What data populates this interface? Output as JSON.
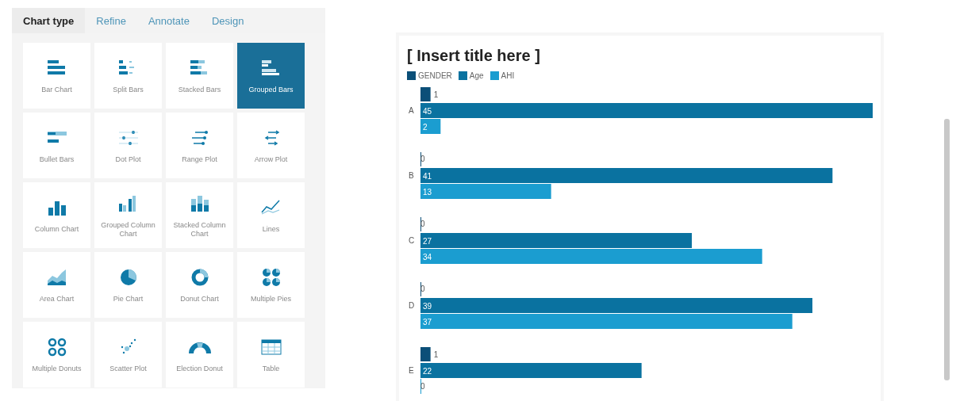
{
  "tabs": [
    {
      "label": "Chart type",
      "selected": true
    },
    {
      "label": "Refine",
      "selected": false
    },
    {
      "label": "Annotate",
      "selected": false
    },
    {
      "label": "Design",
      "selected": false
    }
  ],
  "chart_types": [
    {
      "label": "Bar Chart",
      "kind": "bar",
      "selected": false
    },
    {
      "label": "Split Bars",
      "kind": "split",
      "selected": false
    },
    {
      "label": "Stacked Bars",
      "kind": "stacked",
      "selected": false
    },
    {
      "label": "Grouped Bars",
      "kind": "grouped",
      "selected": true
    },
    {
      "label": "Bullet Bars",
      "kind": "bullet",
      "selected": false
    },
    {
      "label": "Dot Plot",
      "kind": "dot",
      "selected": false
    },
    {
      "label": "Range Plot",
      "kind": "range",
      "selected": false
    },
    {
      "label": "Arrow Plot",
      "kind": "arrow",
      "selected": false
    },
    {
      "label": "Column Chart",
      "kind": "column",
      "selected": false
    },
    {
      "label": "Grouped Column Chart",
      "kind": "grouped-column",
      "selected": false
    },
    {
      "label": "Stacked Column Chart",
      "kind": "stacked-column",
      "selected": false
    },
    {
      "label": "Lines",
      "kind": "lines",
      "selected": false
    },
    {
      "label": "Area Chart",
      "kind": "area",
      "selected": false
    },
    {
      "label": "Pie Chart",
      "kind": "pie",
      "selected": false
    },
    {
      "label": "Donut Chart",
      "kind": "donut",
      "selected": false
    },
    {
      "label": "Multiple Pies",
      "kind": "multi-pie",
      "selected": false
    },
    {
      "label": "Multiple Donuts",
      "kind": "multi-donut",
      "selected": false
    },
    {
      "label": "Scatter Plot",
      "kind": "scatter",
      "selected": false
    },
    {
      "label": "Election Donut",
      "kind": "election",
      "selected": false
    },
    {
      "label": "Table",
      "kind": "table",
      "selected": false
    }
  ],
  "preview": {
    "chart_data": {
      "type": "bar",
      "orientation": "horizontal",
      "title": "[ Insert title here ]",
      "categories": [
        "A",
        "B",
        "C",
        "D",
        "E"
      ],
      "data_labels": true,
      "series": [
        {
          "name": "GENDER",
          "color": "#0b4f78",
          "values": [
            1,
            0,
            0,
            0,
            1
          ]
        },
        {
          "name": "Age",
          "color": "#0a72a0",
          "values": [
            45,
            41,
            27,
            39,
            22
          ]
        },
        {
          "name": "AHI",
          "color": "#1b9dd0",
          "values": [
            2,
            13,
            34,
            37,
            0
          ]
        }
      ]
    }
  }
}
